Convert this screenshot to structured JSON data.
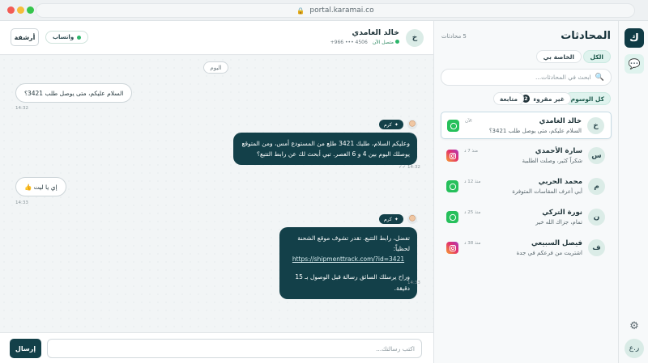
{
  "browser": {
    "url": "portal.karamai.co"
  },
  "rail": {
    "logo_letter": "ك",
    "avatar_text": "ر.ع"
  },
  "conversations": {
    "title": "المحادثات",
    "count": "5 محادثات",
    "filters": [
      {
        "label": "الكل",
        "active": true
      },
      {
        "label": "الخاصة بي",
        "active": false
      }
    ],
    "search_placeholder": "ابحث في المحادثات...",
    "tags": [
      {
        "label": "كل الوسوم",
        "active": true
      },
      {
        "label": "غير مقروء",
        "badge": "2",
        "active": false
      },
      {
        "label": "متابعة",
        "active": false
      }
    ],
    "items": [
      {
        "initial": "خ",
        "name": "خالد الغامدي",
        "preview": "السلام عليكم، متى يوصل طلب 3421؟",
        "time": "الآن",
        "channel": "whatsapp",
        "selected": true
      },
      {
        "initial": "س",
        "name": "سارة الأحمدي",
        "preview": "شكراً كثير، وصلت الطلبية",
        "time": "منذ 7 د",
        "channel": "instagram",
        "selected": false
      },
      {
        "initial": "م",
        "name": "محمد الحربي",
        "preview": "أبي أعرف المقاسات المتوفرة",
        "time": "منذ 12 د",
        "channel": "whatsapp",
        "selected": false
      },
      {
        "initial": "ن",
        "name": "نورة التركي",
        "preview": "تمام، جزاك الله خير",
        "time": "منذ 25 د",
        "channel": "whatsapp",
        "selected": false
      },
      {
        "initial": "ف",
        "name": "فيصل السبيعي",
        "preview": "اشتريت من فرعكم في جدة",
        "time": "منذ 38 د",
        "channel": "instagram",
        "selected": false
      }
    ]
  },
  "chat": {
    "contact": {
      "initial": "خ",
      "name": "خالد الغامدي",
      "phone": "+966 ••• 4506",
      "status": "متصل الآن"
    },
    "channel_label": "واتساب",
    "archive_label": "أرشفة",
    "day_label": "اليوم",
    "messages": [
      {
        "dir": "in",
        "text": "السلام عليكم، متى يوصل طلب 3421؟",
        "time": "14:32"
      },
      {
        "dir": "out",
        "agent": "كرم",
        "lines": [
          "وعليكم السلام، طلبك 3421 طلع من المستودع أمس، ومن المتوقع",
          "يوصلك اليوم بين 4 و 6 العصر. تبي أبحث لك عن رابط التتبع؟"
        ],
        "time": "14:32 ✓✓"
      },
      {
        "dir": "in",
        "text": "إي يا ليت 👍",
        "time": "14:33"
      },
      {
        "dir": "out",
        "agent": "كرم",
        "lines": [
          "تفضل، رابط التتبع. تقدر تشوف موقع الشحنة لحظياً:"
        ],
        "link": "https://shipmenttrack.com/?id=3421",
        "footer": "وراح يرسلك السائق رسالة قبل الوصول بـ 15 دقيقة.",
        "time": "14:33"
      }
    ]
  },
  "composer": {
    "placeholder": "اكتب رسالتك...",
    "send_label": "إرسال"
  }
}
